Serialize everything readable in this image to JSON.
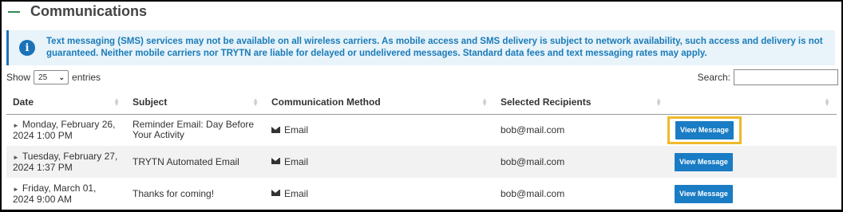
{
  "section": {
    "title": "Communications"
  },
  "info": {
    "text": "Text messaging (SMS) services may not be available on all wireless carriers. As mobile access and SMS delivery is subject to network availability, such access and delivery is not guaranteed. Neither mobile carriers nor TRYTN are liable for delayed or undelivered messages. Standard data fees and text messaging rates may apply."
  },
  "controls": {
    "show_label": "Show",
    "entries_value": "25",
    "entries_label": "entries",
    "search_label": "Search:",
    "search_value": ""
  },
  "table": {
    "headers": [
      "Date",
      "Subject",
      "Communication Method",
      "Selected Recipients",
      ""
    ],
    "rows": [
      {
        "date_line1": "Monday, February 26,",
        "date_line2": "2024 1:00 PM",
        "subject": "Reminder Email: Day Before Your Activity",
        "method": "Email",
        "recipients": "bob@mail.com",
        "action": "View Message"
      },
      {
        "date_line1": "Tuesday, February 27,",
        "date_line2": "2024 1:37 PM",
        "subject": "TRYTN Automated Email",
        "method": "Email",
        "recipients": "bob@mail.com",
        "action": "View Message"
      },
      {
        "date_line1": "Friday, March 01,",
        "date_line2": "2024 9:00 AM",
        "subject": "Thanks for coming!",
        "method": "Email",
        "recipients": "bob@mail.com",
        "action": "View Message"
      }
    ]
  },
  "icons": {
    "section_toggle": "minus-icon",
    "info": "info-icon",
    "expand": "triangle-right-icon",
    "method": "envelope-icon",
    "sort": "sort-icon",
    "select": "chevron-down-icon"
  },
  "colors": {
    "accent": "#1a7cc4",
    "highlight": "#f0b92b",
    "toggle": "#2e8b57"
  }
}
